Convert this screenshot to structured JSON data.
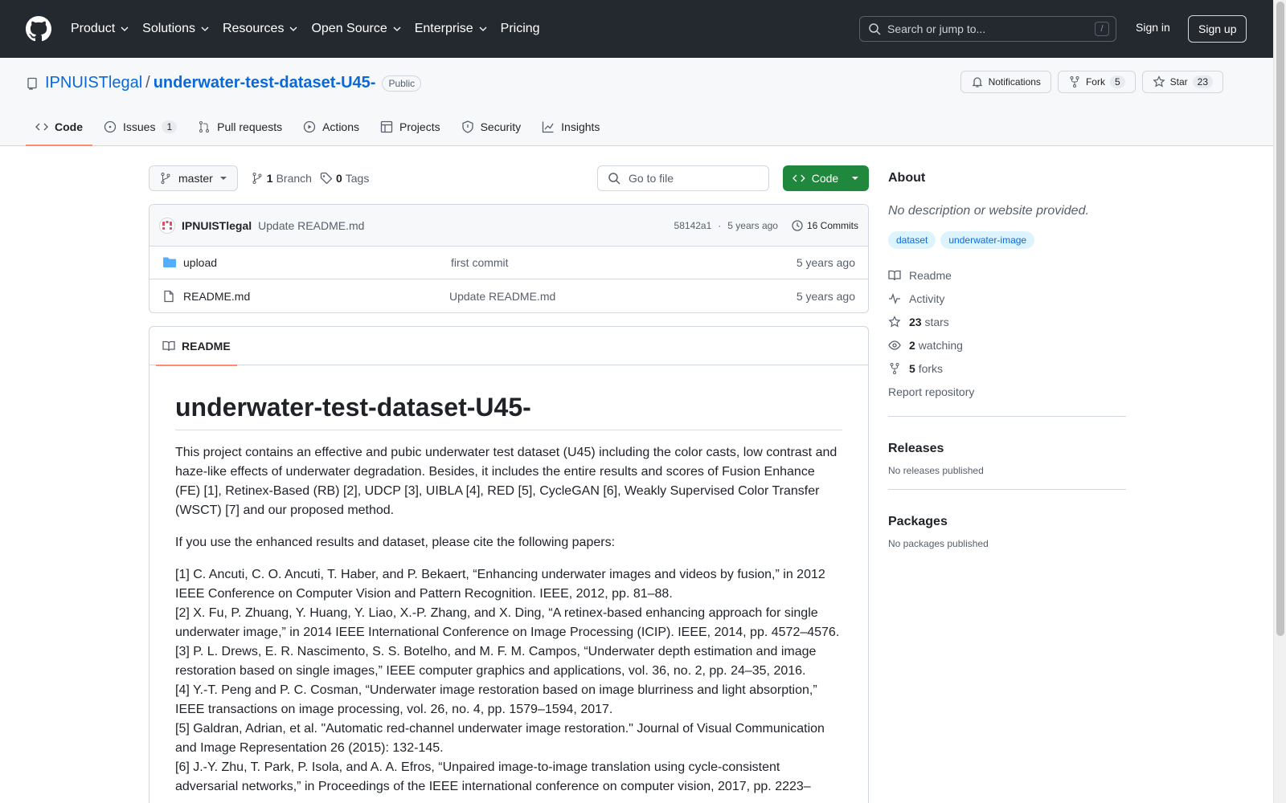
{
  "header": {
    "nav": [
      "Product",
      "Solutions",
      "Resources",
      "Open Source",
      "Enterprise",
      "Pricing"
    ],
    "search_placeholder": "Search or jump to...",
    "search_shortcut": "/",
    "sign_in": "Sign in",
    "sign_up": "Sign up"
  },
  "repo": {
    "owner": "IPNUISTlegal",
    "separator": "/",
    "name": "underwater-test-dataset-U45-",
    "visibility": "Public",
    "notifications_label": "Notifications",
    "fork_label": "Fork",
    "fork_count": "5",
    "star_label": "Star",
    "star_count": "23"
  },
  "tabs": [
    {
      "label": "Code"
    },
    {
      "label": "Issues",
      "count": "1"
    },
    {
      "label": "Pull requests"
    },
    {
      "label": "Actions"
    },
    {
      "label": "Projects"
    },
    {
      "label": "Security"
    },
    {
      "label": "Insights"
    }
  ],
  "toolbar": {
    "branch": "master",
    "branch_count": "1",
    "branch_label": "Branch",
    "tag_count": "0",
    "tag_label": "Tags",
    "goto_placeholder": "Go to file",
    "code_button": "Code"
  },
  "latest_commit": {
    "author": "IPNUISTlegal",
    "message": "Update README.md",
    "hash": "58142a1",
    "dot": "·",
    "age": "5 years ago",
    "commits_label": "16 Commits"
  },
  "files": [
    {
      "name": "upload",
      "type": "folder",
      "commit": "first commit",
      "age": "5 years ago"
    },
    {
      "name": "README.md",
      "type": "file",
      "commit": "Update README.md",
      "age": "5 years ago"
    }
  ],
  "readme": {
    "tab_label": "README",
    "title": "underwater-test-dataset-U45-",
    "intro": "This project contains an effective and pubic underwater test dataset (U45) including the color casts, low contrast and haze-like effects of underwater degradation. Besides, it includes the entire results and scores of Fusion Enhance (FE) [1], Retinex-Based (RB) [2], UDCP [3], UIBLA [4], RED [5], CycleGAN [6], Weakly Supervised Color Transfer (WSCT) [7] and our proposed method.",
    "cite": "If you use the enhanced results and dataset, please cite the following papers:",
    "refs": [
      "[1] C. Ancuti, C. O. Ancuti, T. Haber, and P. Bekaert, “Enhancing underwater images and videos by fusion,” in 2012 IEEE Conference on Computer Vision and Pattern Recognition. IEEE, 2012, pp. 81–88.",
      "[2] X. Fu, P. Zhuang, Y. Huang, Y. Liao, X.-P. Zhang, and X. Ding, “A retinex-based enhancing approach for single underwater image,” in 2014 IEEE International Conference on Image Processing (ICIP). IEEE, 2014, pp. 4572–4576.",
      "[3] P. L. Drews, E. R. Nascimento, S. S. Botelho, and M. F. M. Campos, “Underwater depth estimation and image restoration based on single images,” IEEE computer graphics and applications, vol. 36, no. 2, pp. 24–35, 2016.",
      "[4] Y.-T. Peng and P. C. Cosman, “Underwater image restoration based on image blurriness and light absorption,” IEEE transactions on image processing, vol. 26, no. 4, pp. 1579–1594, 2017.",
      "[5] Galdran, Adrian, et al. \"Automatic red-channel underwater image restoration.\" Journal of Visual Communication and Image Representation 26 (2015): 132-145.",
      "[6] J.-Y. Zhu, T. Park, P. Isola, and A. A. Efros, “Unpaired image-to-image translation using cycle-consistent adversarial networks,” in Proceedings of the IEEE international conference on computer vision, 2017, pp. 2223–"
    ]
  },
  "about": {
    "heading": "About",
    "description": "No description or website provided.",
    "topics": [
      "dataset",
      "underwater-image"
    ],
    "readme": "Readme",
    "activity": "Activity",
    "stars_count": "23",
    "stars_label": "stars",
    "watching_count": "2",
    "watching_label": "watching",
    "forks_count": "5",
    "forks_label": "forks",
    "report": "Report repository"
  },
  "releases": {
    "heading": "Releases",
    "text": "No releases published"
  },
  "packages": {
    "heading": "Packages",
    "text": "No packages published"
  }
}
